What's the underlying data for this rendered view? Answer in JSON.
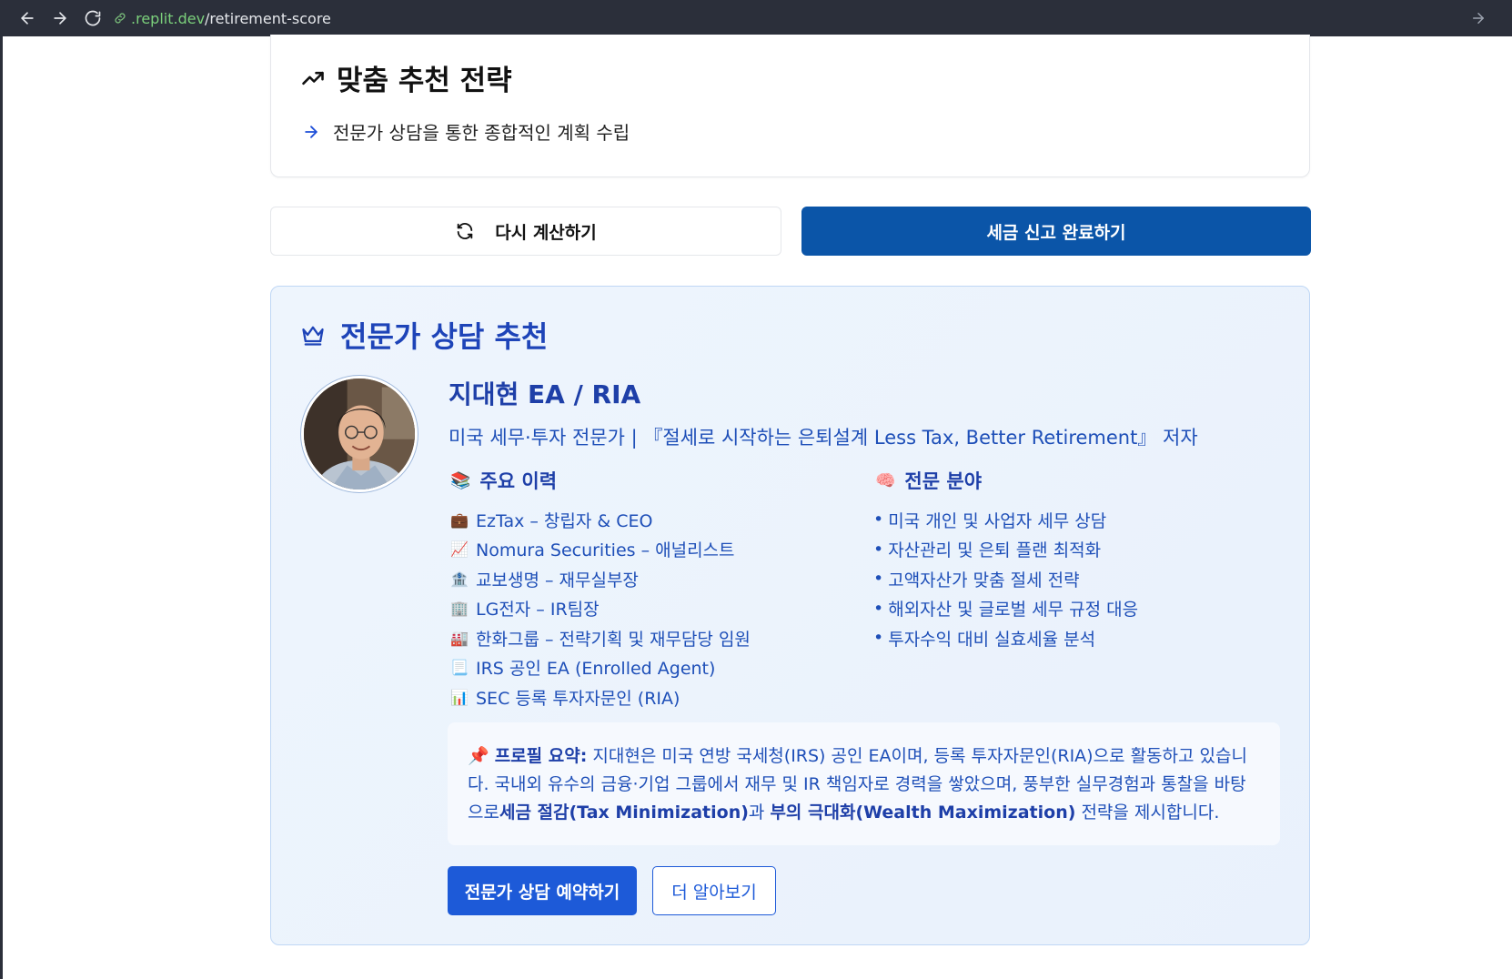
{
  "browser": {
    "url_host": ".replit.dev",
    "url_path": "/retirement-score"
  },
  "strategy": {
    "title": "맞춤 추천 전략",
    "items": [
      "전문가 상담을 통한 종합적인 계획 수립"
    ]
  },
  "actions": {
    "recalc_label": "다시 계산하기",
    "complete_label": "세금 신고 완료하기"
  },
  "expert": {
    "heading": "전문가 상담 추천",
    "name": "지대현 EA / RIA",
    "subtitle": "미국 세무·투자 전문가 | 『절세로 시작하는 은퇴설계 Less Tax, Better Retirement』 저자",
    "career_title": "주요 이력",
    "career_title_icon": "📚",
    "career": [
      {
        "icon": "💼",
        "text": "EzTax – 창립자 & CEO"
      },
      {
        "icon": "📈",
        "text": "Nomura Securities – 애널리스트"
      },
      {
        "icon": "🏦",
        "text": "교보생명 – 재무실부장"
      },
      {
        "icon": "🏢",
        "text": "LG전자 – IR팀장"
      },
      {
        "icon": "🏭",
        "text": "한화그룹 – 전략기획 및 재무담당 임원"
      },
      {
        "icon": "📃",
        "text": "IRS 공인 EA (Enrolled Agent)"
      },
      {
        "icon": "📊",
        "text": "SEC 등록 투자자문인 (RIA)"
      }
    ],
    "field_title": "전문 분야",
    "field_title_icon": "🧠",
    "fields": [
      "미국 개인 및 사업자 세무 상담",
      "자산관리 및 은퇴 플랜 최적화",
      "고액자산가 맞춤 절세 전략",
      "해외자산 및 글로벌 세무 규정 대응",
      "투자수익 대비 실효세율 분석"
    ],
    "profile": {
      "icon": "📌",
      "label": "프로필 요약:",
      "text1": " 지대현은 미국 연방 국세청(IRS) 공인 EA이며, 등록 투자자문인(RIA)으로 활동하고 있습니다. 국내외 유수의 금융·기업 그룹에서 재무 및 IR 책임자로 경력을 쌓았으며, 풍부한 실무경험과 통찰을 바탕으로",
      "strong1": "세금 절감(Tax Minimization)",
      "text2": "과 ",
      "strong2": "부의 극대화(Wealth Maximization)",
      "text3": " 전략을 제시합니다."
    },
    "book_label": "전문가 상담 예약하기",
    "more_label": "더 알아보기"
  },
  "colors": {
    "primary": "#0b55a8",
    "accent": "#1d5ad8",
    "heading_blue": "#1e44b8"
  }
}
